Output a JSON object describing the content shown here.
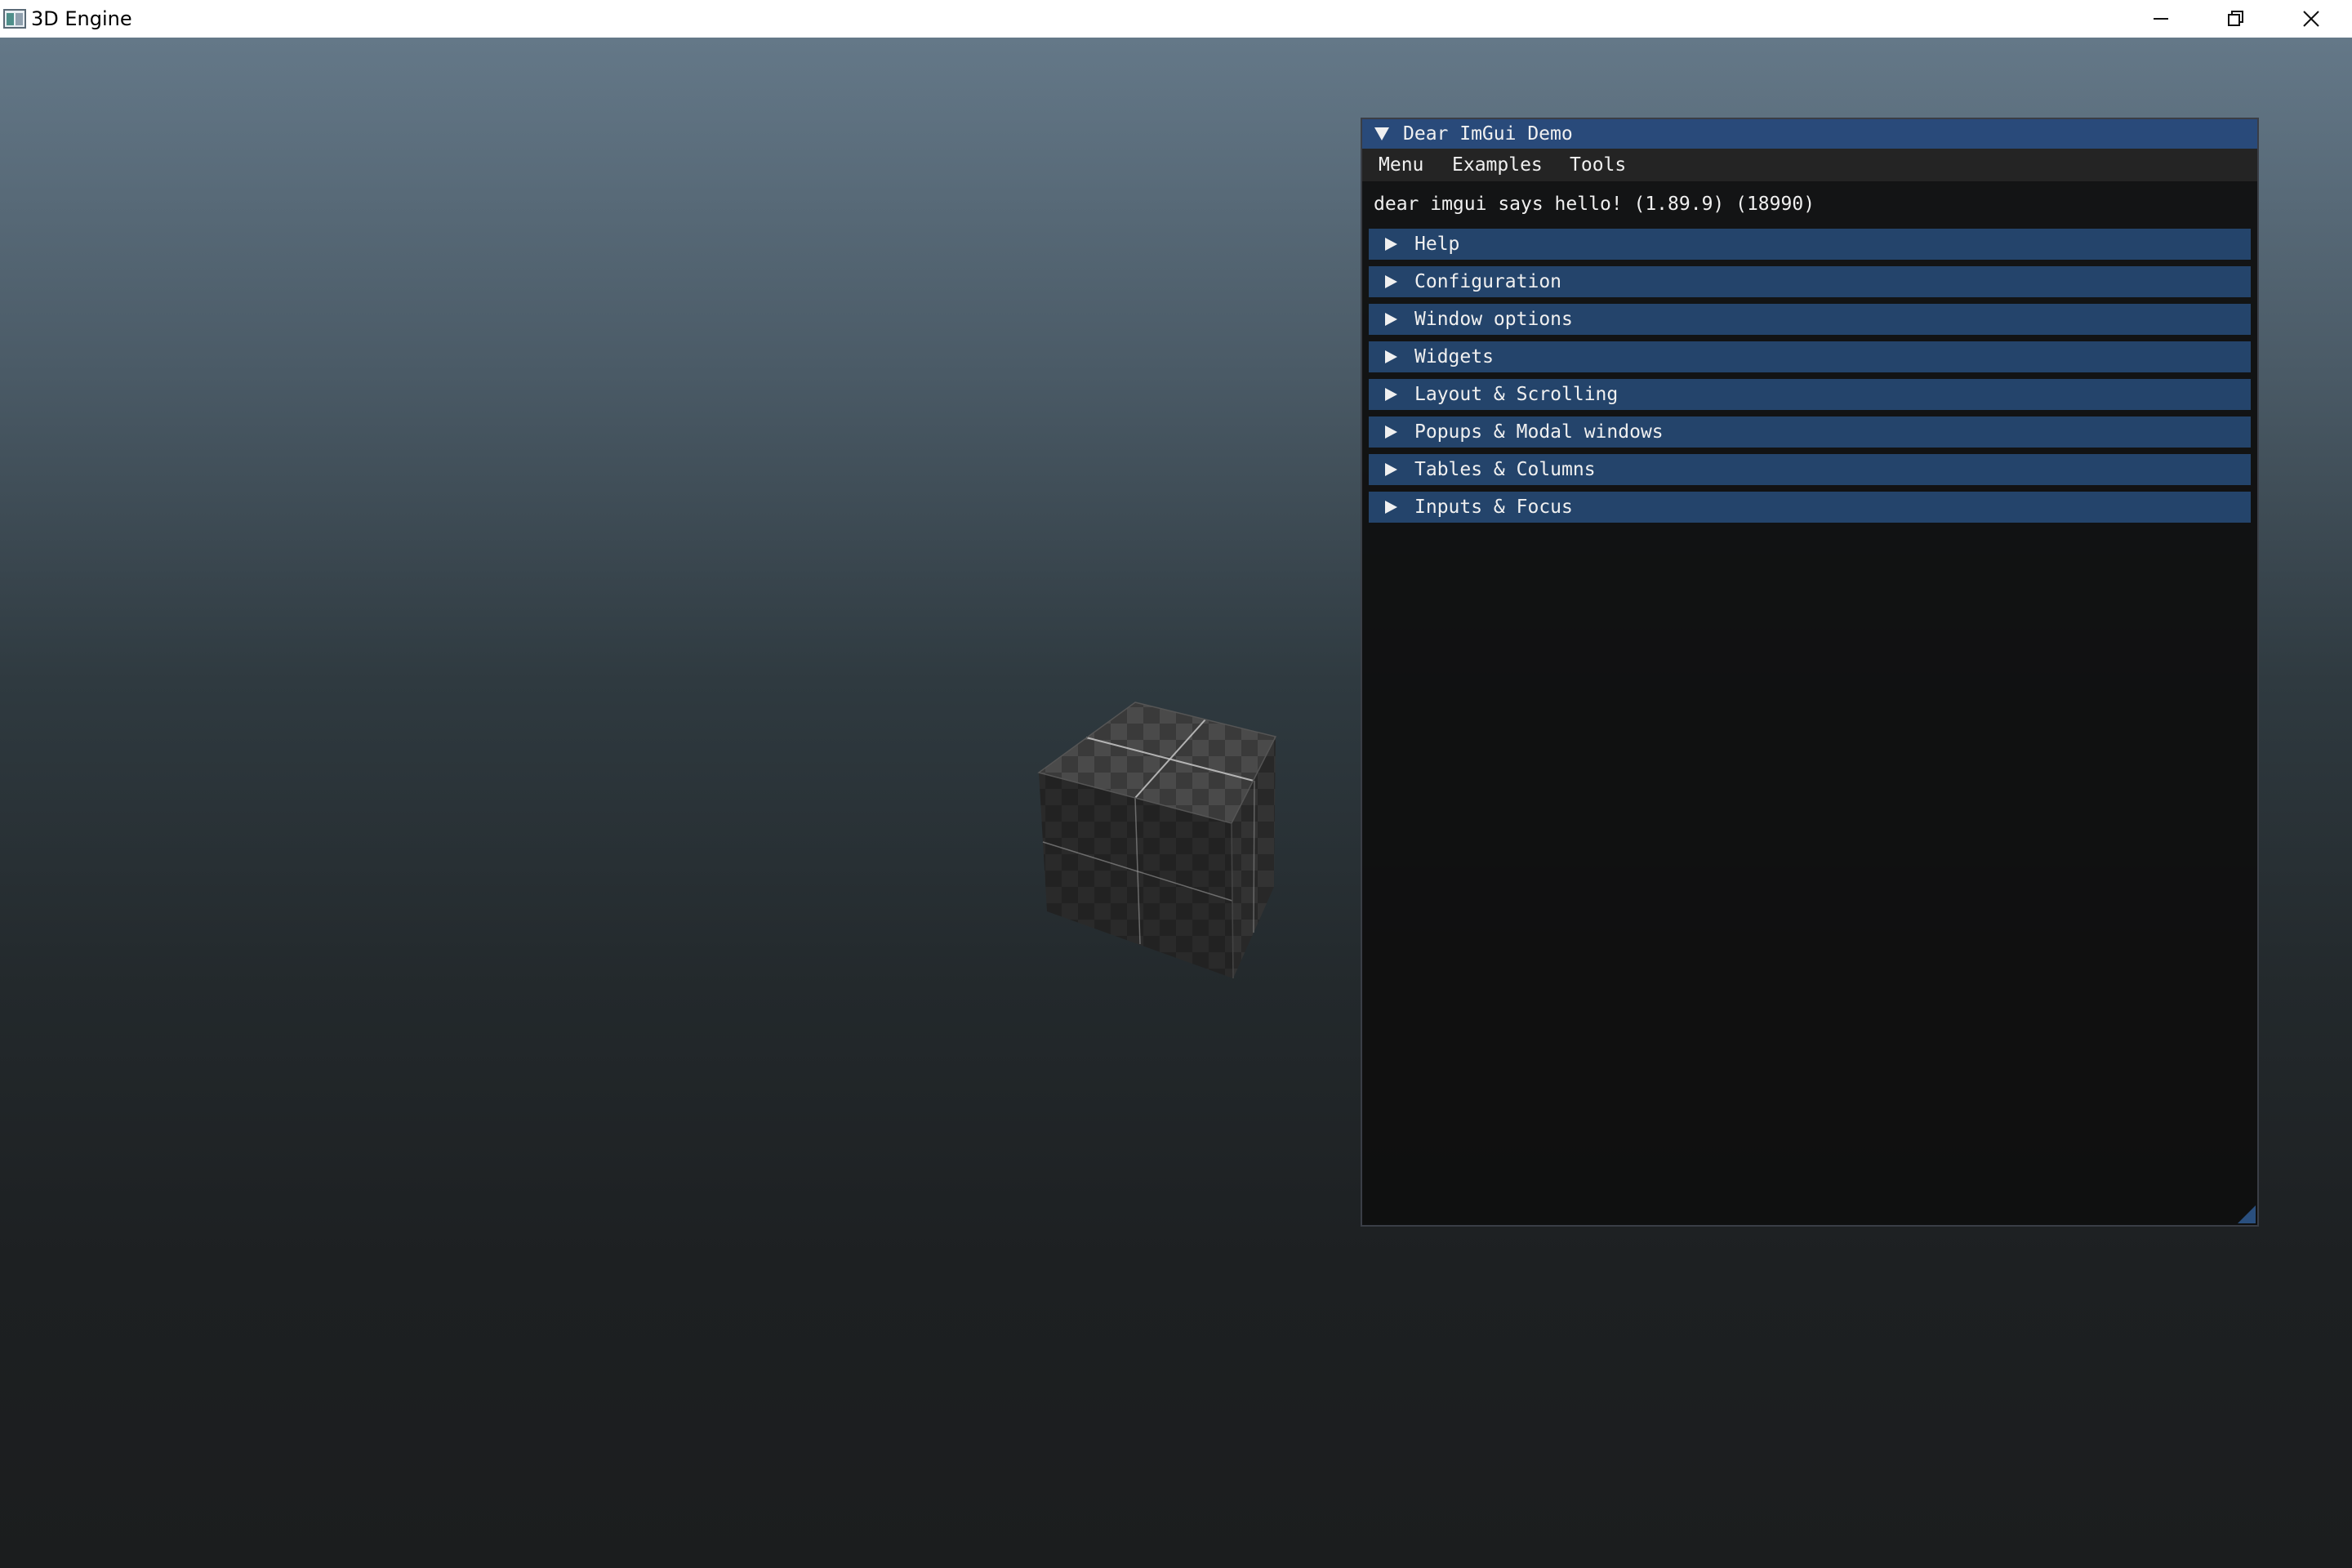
{
  "window": {
    "title": "3D Engine",
    "icon": "app-icon",
    "controls": [
      "minimize-icon",
      "restore-icon",
      "close-icon"
    ]
  },
  "imgui": {
    "title": "Dear ImGui Demo",
    "menu": [
      "Menu",
      "Examples",
      "Tools"
    ],
    "hello_text": "dear imgui says hello! (1.89.9) (18990)",
    "headers": [
      "Help",
      "Configuration",
      "Window options",
      "Widgets",
      "Layout & Scrolling",
      "Popups & Modal windows",
      "Tables & Columns",
      "Inputs & Focus"
    ]
  },
  "colors": {
    "title_active": "#294a7a",
    "header": "#24446b",
    "window_bg": "#0f0f0f",
    "menubar_bg": "#242424"
  }
}
